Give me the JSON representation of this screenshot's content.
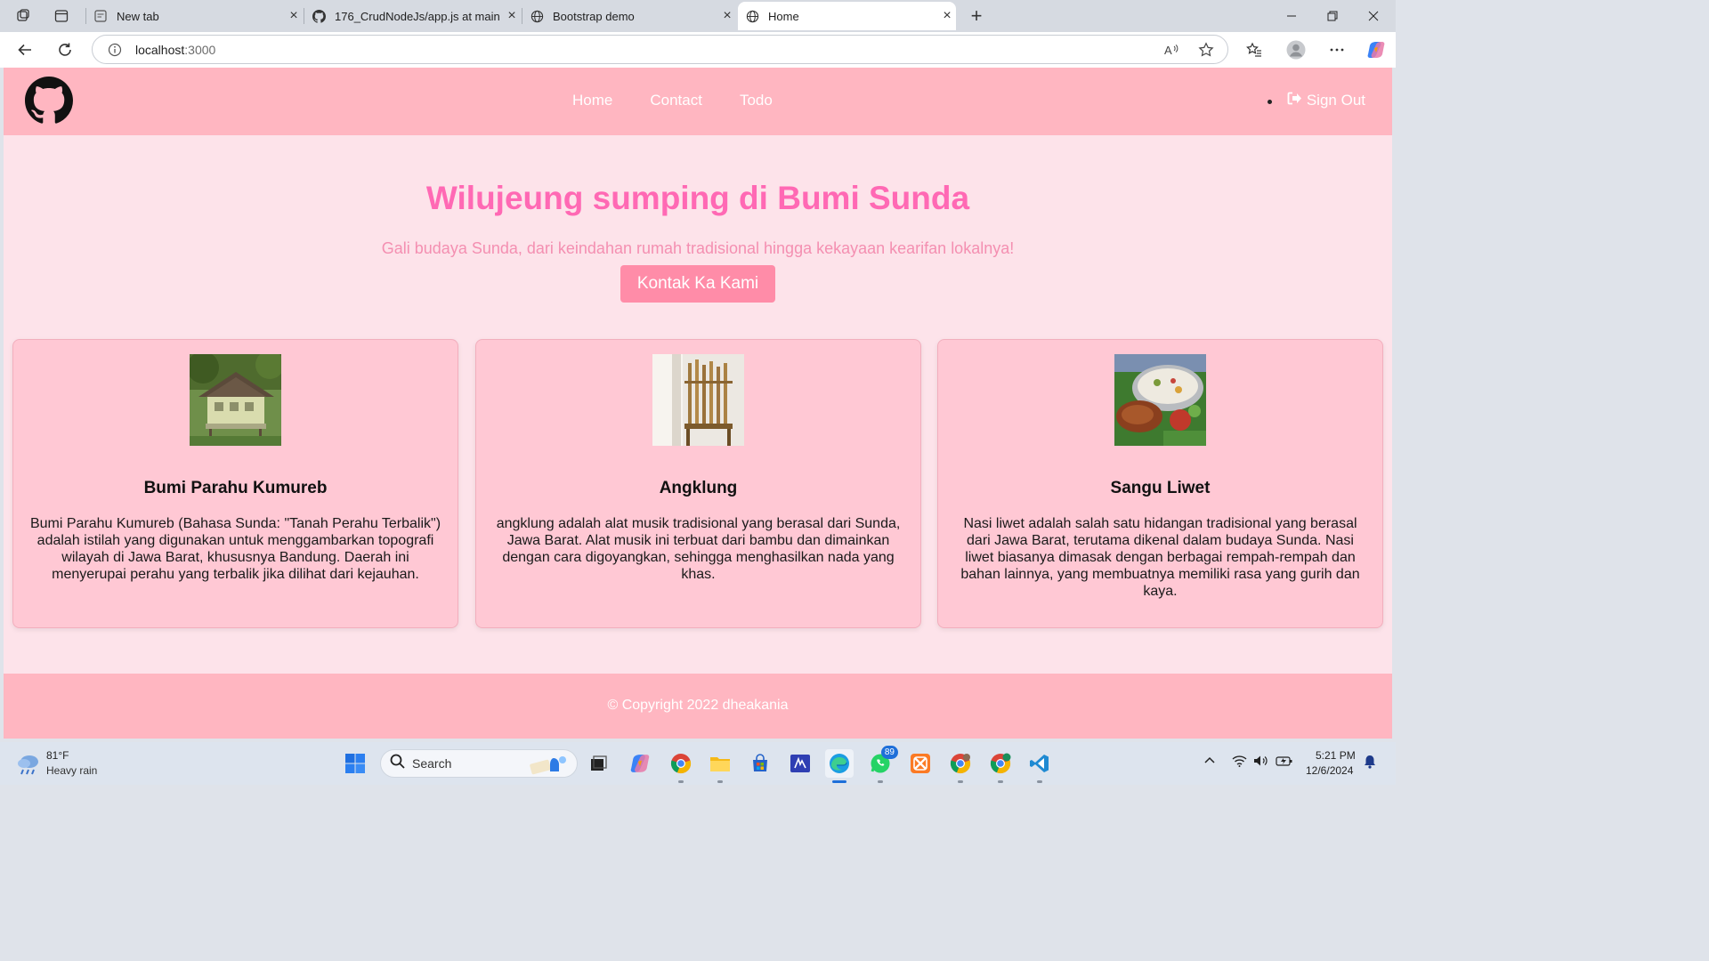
{
  "browser": {
    "tabs": [
      {
        "title": "New tab",
        "icon": "newtab-icon"
      },
      {
        "title": "176_CrudNodeJs/app.js at main ·",
        "icon": "github-icon"
      },
      {
        "title": "Bootstrap demo",
        "icon": "globe-icon"
      },
      {
        "title": "Home",
        "icon": "globe-icon",
        "active": true
      }
    ],
    "address": {
      "host": "localhost",
      "port": ":3000"
    }
  },
  "navbar": {
    "links": [
      "Home",
      "Contact",
      "Todo"
    ],
    "sign_out": "Sign Out"
  },
  "hero": {
    "title": "Wilujeung sumping di Bumi Sunda",
    "subtitle": "Gali budaya Sunda, dari keindahan rumah tradisional hingga kekayaan kearifan lokalnya!",
    "button": "Kontak Ka Kami"
  },
  "cards": [
    {
      "title": "Bumi Parahu Kumureb",
      "text": "Bumi Parahu Kumureb (Bahasa Sunda: \"Tanah Perahu Terbalik\") adalah istilah yang digunakan untuk menggambarkan topografi wilayah di Jawa Barat, khususnya Bandung. Daerah ini menyerupai perahu yang terbalik jika dilihat dari kejauhan."
    },
    {
      "title": "Angklung",
      "text": "angklung adalah alat musik tradisional yang berasal dari Sunda, Jawa Barat. Alat musik ini terbuat dari bambu dan dimainkan dengan cara digoyangkan, sehingga menghasilkan nada yang khas."
    },
    {
      "title": "Sangu Liwet",
      "text": "Nasi liwet adalah salah satu hidangan tradisional yang berasal dari Jawa Barat, terutama dikenal dalam budaya Sunda. Nasi liwet biasanya dimasak dengan berbagai rempah-rempah dan bahan lainnya, yang membuatnya memiliki rasa yang gurih dan kaya."
    }
  ],
  "footer": {
    "text": "© Copyright 2022 dheakania"
  },
  "taskbar": {
    "weather_temp": "81°F",
    "weather_desc": "Heavy rain",
    "search_label": "Search",
    "whatsapp_badge": "89",
    "time": "5:21 PM",
    "date": "12/6/2024"
  },
  "colors": {
    "navbar": "#ffb6c1",
    "page_bg": "#fde3ea",
    "hero_title": "#ff69b4",
    "card_bg": "#ffc8d4",
    "button": "#ff8ca8"
  }
}
